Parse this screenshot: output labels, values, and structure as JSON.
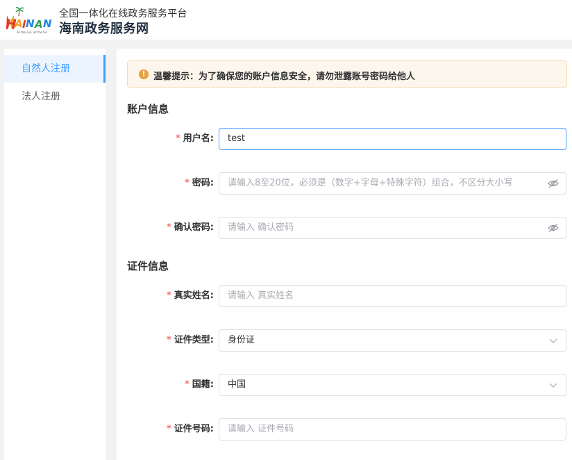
{
  "header": {
    "logo_text": "HAINAN",
    "logo_tagline": "All the sun, all the fun",
    "subtitle": "全国一体化在线政务服务平台",
    "title": "海南政务服务网"
  },
  "sidebar": {
    "items": [
      {
        "label": "自然人注册",
        "active": true
      },
      {
        "label": "法人注册",
        "active": false
      }
    ]
  },
  "alert": {
    "icon": "warning-icon",
    "text": "温馨提示：为了确保您的账户信息安全，请勿泄露账号密码给他人"
  },
  "sections": {
    "account": "账户信息",
    "certificate": "证件信息"
  },
  "form": {
    "username": {
      "label": "用户名:",
      "value": "test"
    },
    "password": {
      "label": "密码:",
      "placeholder": "请输入8至20位，必须是（数字+字母+特殊字符）组合，不区分大小写"
    },
    "confirm_password": {
      "label": "确认密码:",
      "placeholder": "请输入 确认密码"
    },
    "real_name": {
      "label": "真实姓名:",
      "placeholder": "请输入 真实姓名"
    },
    "cert_type": {
      "label": "证件类型:",
      "value": "身份证"
    },
    "nationality": {
      "label": "国籍:",
      "value": "中国"
    },
    "cert_number": {
      "label": "证件号码:",
      "placeholder": "请输入 证件号码"
    }
  },
  "required_mark": "*",
  "colors": {
    "primary": "#409eff",
    "warning": "#e6a23c",
    "required": "#f56c6c"
  }
}
